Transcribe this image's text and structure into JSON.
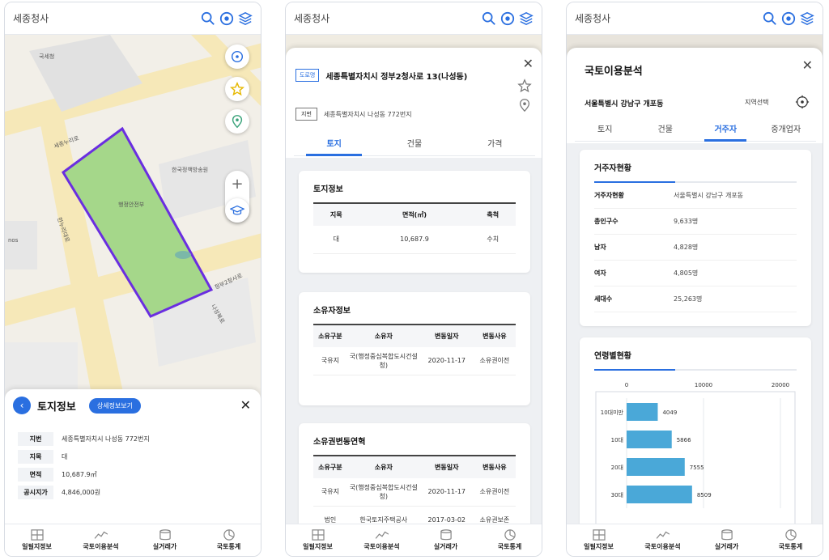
{
  "app_title": "세종청사",
  "nav": {
    "items": [
      {
        "label": "일필지정보",
        "icon": "grid-icon"
      },
      {
        "label": "국토이용분석",
        "icon": "trend-icon"
      },
      {
        "label": "실거래가",
        "icon": "database-icon"
      },
      {
        "label": "국토통계",
        "icon": "pie-icon"
      }
    ]
  },
  "screen1": {
    "map_labels": {
      "l1": "국세청",
      "l2": "세종누리로",
      "l3": "한국정책방송원",
      "l4": "한누리대로",
      "l5": "행정안전부",
      "l6": "정부2청사로",
      "l7": "나성북로",
      "l8": "nos"
    },
    "sheet": {
      "title": "토지정보",
      "detail_button": "상세정보보기",
      "rows": [
        {
          "k": "지번",
          "v": "세종특별자치시 나성동 772번지"
        },
        {
          "k": "지목",
          "v": "대"
        },
        {
          "k": "면적",
          "v": "10,687.9㎡"
        },
        {
          "k": "공시지가",
          "v": "4,846,000원"
        }
      ]
    }
  },
  "screen2": {
    "road_badge": "도로명",
    "road_address": "세종특별자치시 정부2청사로 13(나성동)",
    "lot_badge": "지번",
    "lot_address": "세종특별자치시 나성동 772번지",
    "tabs": [
      "토지",
      "건물",
      "가격"
    ],
    "land_card": {
      "title": "토지정보",
      "headers": [
        "지목",
        "면적(㎡)",
        "축척"
      ],
      "row": [
        "대",
        "10,687.9",
        "수치"
      ]
    },
    "owner_card": {
      "title": "소유자정보",
      "headers": [
        "소유구분",
        "소유자",
        "변동일자",
        "변동사유"
      ],
      "row": [
        "국유지",
        "국(행정중심복합도시건설청)",
        "2020-11-17",
        "소유권이전"
      ]
    },
    "history_card": {
      "title": "소유권변동연혁",
      "headers": [
        "소유구분",
        "소유자",
        "변동일자",
        "변동사유"
      ],
      "rows": [
        [
          "국유지",
          "국(행정중심복합도시건설청)",
          "2020-11-17",
          "소유권이전"
        ],
        [
          "법인",
          "한국토지주택공사",
          "2017-03-02",
          "소유권보존"
        ]
      ]
    }
  },
  "screen3": {
    "title": "국토이용분석",
    "region": "서울특별시 강남구 개포동",
    "region_button": "지역선택",
    "tabs": [
      "토지",
      "건물",
      "거주자",
      "중개업자"
    ],
    "resident_card": {
      "title": "거주자현황",
      "rows": [
        {
          "k": "거주자현황",
          "v": "서울특별시 강남구 개포동"
        },
        {
          "k": "총인구수",
          "v": "9,633명"
        },
        {
          "k": "남자",
          "v": "4,828명"
        },
        {
          "k": "여자",
          "v": "4,805명"
        },
        {
          "k": "세대수",
          "v": "25,263명"
        }
      ]
    },
    "age_card": {
      "title": "연령별현황"
    }
  },
  "chart_data": {
    "type": "bar",
    "orientation": "horizontal",
    "categories": [
      "10대미만",
      "10대",
      "20대",
      "30대"
    ],
    "values": [
      4049,
      5866,
      7555,
      8509
    ],
    "xlim": [
      0,
      20000
    ],
    "xticks": [
      "0",
      "10000",
      "20000"
    ],
    "bar_color": "#4aa8d8"
  },
  "colors": {
    "accent": "#2a6fe0",
    "parcel_fill": "#a5d78a",
    "parcel_stroke": "#6a2ee0"
  }
}
